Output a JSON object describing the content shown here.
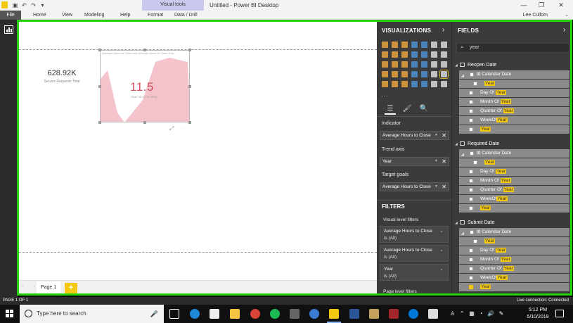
{
  "titlebar": {
    "visual_tools_label": "Visual tools",
    "window_title": "Untitled - Power BI Desktop",
    "minimize": "—",
    "restore": "❐",
    "close": "✕"
  },
  "ribbon": {
    "file": "File",
    "tabs": [
      "Home",
      "View",
      "Modeling",
      "Help",
      "Format",
      "Data / Drill"
    ],
    "user": "Lee Cullom"
  },
  "canvas": {
    "card_value": "628.92K",
    "card_label": "Service Requests Total",
    "kpi_title": "Average Hours to Close and Average Hours to Close Goa...",
    "kpi_value": "11.5",
    "kpi_goal": "Goal: 46.0 (-75.29%)",
    "visual_header_icons": "⤢ ⋯"
  },
  "pages": {
    "tabs": [
      "Page 1"
    ],
    "add": "+"
  },
  "visualizations": {
    "header": "VISUALIZATIONS",
    "more": "...",
    "wells": [
      {
        "label": "Indicator",
        "field": "Average Hours to Close"
      },
      {
        "label": "Trend axis",
        "field": "Year"
      },
      {
        "label": "Target goals",
        "field": "Average Hours to Close"
      }
    ],
    "filters_header": "FILTERS",
    "visual_level_label": "Visual level filters",
    "filter_cards": [
      {
        "name": "Average Hours to Close",
        "state": "is (All)"
      },
      {
        "name": "Average Hours to Close",
        "state": "is (All)"
      },
      {
        "name": "Year",
        "state": "is (All)"
      }
    ],
    "page_level_label": "Page level filters"
  },
  "fields": {
    "header": "FIELDS",
    "search_value": "year",
    "tables": [
      {
        "name": "Reopen Date",
        "rows": [
          {
            "prefix": "Calendar Date",
            "hl": "",
            "hier": true
          },
          {
            "prefix": "",
            "hl": "Year",
            "child": true
          },
          {
            "prefix": "Day Of ",
            "hl": "Year"
          },
          {
            "prefix": "Month Of ",
            "hl": "Year"
          },
          {
            "prefix": "Quarter Of ",
            "hl": "Year"
          },
          {
            "prefix": "WeekOf",
            "hl": "Year"
          },
          {
            "prefix": "",
            "hl": "Year"
          }
        ]
      },
      {
        "name": "Required Date",
        "rows": [
          {
            "prefix": "Calendar Date",
            "hl": "",
            "hier": true
          },
          {
            "prefix": "",
            "hl": "Year",
            "child": true
          },
          {
            "prefix": "Day Of ",
            "hl": "Year"
          },
          {
            "prefix": "Month Of ",
            "hl": "Year"
          },
          {
            "prefix": "Quarter Of ",
            "hl": "Year"
          },
          {
            "prefix": "WeekOf",
            "hl": "Year"
          },
          {
            "prefix": "",
            "hl": "Year"
          }
        ]
      },
      {
        "name": "Submit Date",
        "rows": [
          {
            "prefix": "Calendar Date",
            "hl": "",
            "hier": true
          },
          {
            "prefix": "",
            "hl": "Year",
            "child": true
          },
          {
            "prefix": "Day Of ",
            "hl": "Year"
          },
          {
            "prefix": "Month Of ",
            "hl": "Year"
          },
          {
            "prefix": "Quarter Of ",
            "hl": "Year"
          },
          {
            "prefix": "WeekOf",
            "hl": "Year"
          },
          {
            "prefix": "",
            "hl": "Year",
            "checked": true
          }
        ]
      }
    ]
  },
  "statusbar": {
    "page": "PAGE 1 OF 1",
    "connection": "Live connection: Connected"
  },
  "taskbar": {
    "search_placeholder": "Type here to search",
    "time": "5:12 PM",
    "date": "5/10/2019"
  },
  "colors": {
    "highlight_frame": "#25d20c",
    "accent": "#f2c811",
    "kpi_value": "#d14c5c",
    "kpi_area": "#f4c3cc"
  }
}
